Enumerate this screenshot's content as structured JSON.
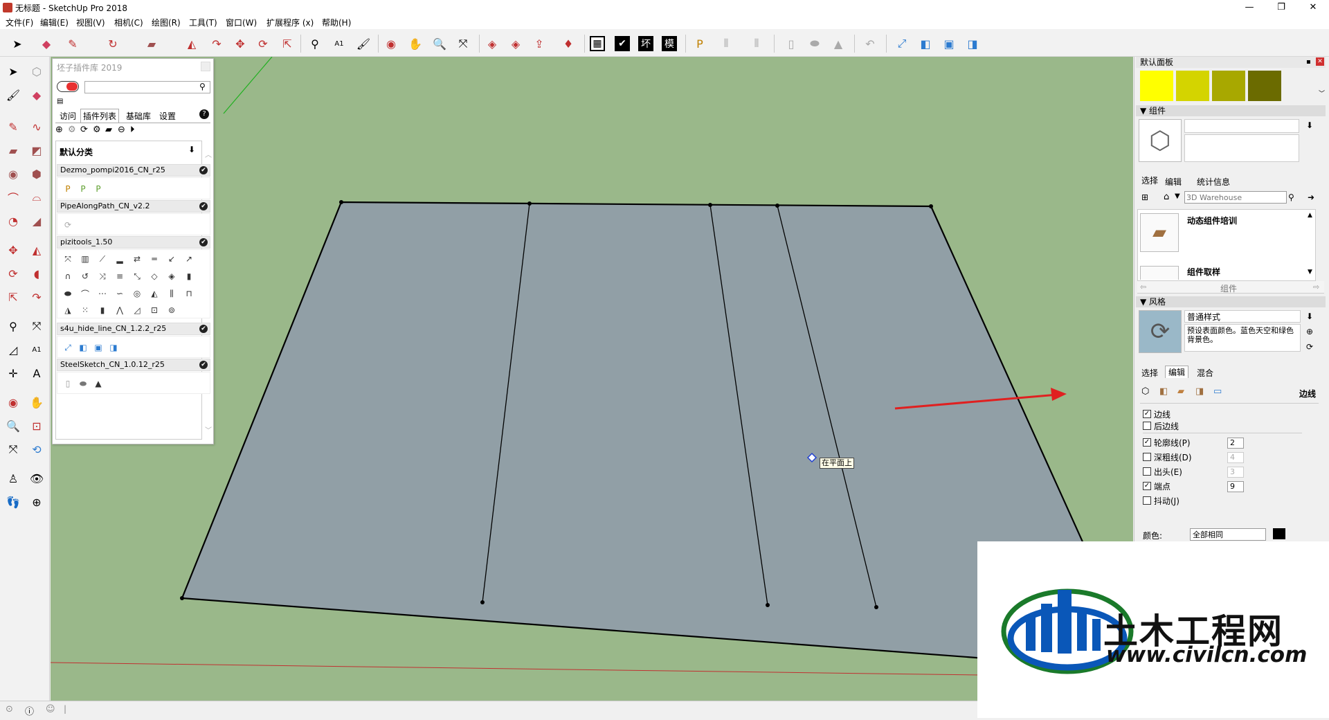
{
  "window": {
    "title": "无标题 - SketchUp Pro 2018",
    "min": "—",
    "max": "❐",
    "close": "✕"
  },
  "menu": [
    "文件(F)",
    "编辑(E)",
    "视图(V)",
    "相机(C)",
    "绘图(R)",
    "工具(T)",
    "窗口(W)",
    "扩展程序 (x)",
    "帮助(H)"
  ],
  "toolbar": {
    "text_icons": [
      "坏",
      "模"
    ],
    "icons": [
      "select-icon",
      "eraser-icon",
      "pencil-icon",
      "arc-icon",
      "rectangle-icon",
      "push-pull-icon",
      "follow-me-icon",
      "move-icon",
      "rotate-icon",
      "scale-icon",
      "tape-icon",
      "text-icon",
      "paint-icon",
      "orbit-icon",
      "pan-icon",
      "zoom-icon",
      "zoom-extents-icon",
      "warehouse-icon",
      "extension-warehouse-icon",
      "share-icon",
      "ruby-icon",
      "table-icon",
      "check-icon",
      "component-icon",
      "section-icon",
      "shadow-icon",
      "fog-icon",
      "cylinder-icon",
      "eraser-soft-icon",
      "weight-icon",
      "undo-icon",
      "hide-line-icon",
      "layer-icon",
      "group-icon",
      "outliner-icon"
    ]
  },
  "plugin": {
    "title": "坯子插件库 2019",
    "tabs": [
      "访问",
      "插件列表",
      "基础库",
      "设置"
    ],
    "help": "?",
    "section_title": "默认分类",
    "categories": [
      "Dezmo_pompi2016_CN_r25",
      "PipeAlongPath_CN_v2.2",
      "pizitools_1.50",
      "s4u_hide_line_CN_1.2.2_r25",
      "SteelSketch_CN_1.0.12_r25"
    ],
    "check": "✔"
  },
  "viewport": {
    "tooltip": "在平面上"
  },
  "tray": {
    "default_panel": "默认面板",
    "swatches": [
      "#ffff00",
      "#d4d400",
      "#a8a800",
      "#6b6b00"
    ],
    "components": {
      "header": "组件",
      "tabs": [
        "选择",
        "编辑",
        "统计信息"
      ],
      "search_placeholder": "3D Warehouse",
      "items": [
        "动态组件培训",
        "组件取样"
      ],
      "footer": "组件"
    },
    "styles": {
      "header": "风格",
      "name": "普通样式",
      "desc": "预设表面颜色。蓝色天空和绿色背景色。",
      "tabs": [
        "选择",
        "编辑",
        "混合"
      ],
      "section": "边线",
      "options": [
        {
          "label": "边线",
          "checked": true
        },
        {
          "label": "后边线",
          "checked": false
        },
        {
          "label": "轮廓线(P)",
          "checked": true,
          "value": "2"
        },
        {
          "label": "深粗线(D)",
          "checked": false,
          "value": "4"
        },
        {
          "label": "出头(E)",
          "checked": false,
          "value": "3"
        },
        {
          "label": "端点",
          "checked": true,
          "value": "9"
        },
        {
          "label": "抖动(J)",
          "checked": false
        }
      ],
      "color_label": "颜色:",
      "color_value": "全部相同"
    }
  },
  "watermark": {
    "brand": "土木工程网",
    "url": "www.civilcn.com"
  },
  "colors": {
    "viewport": "#9ab88a",
    "face": "#919fa6",
    "arrow": "#e02020",
    "accent": "#0a57b8"
  }
}
